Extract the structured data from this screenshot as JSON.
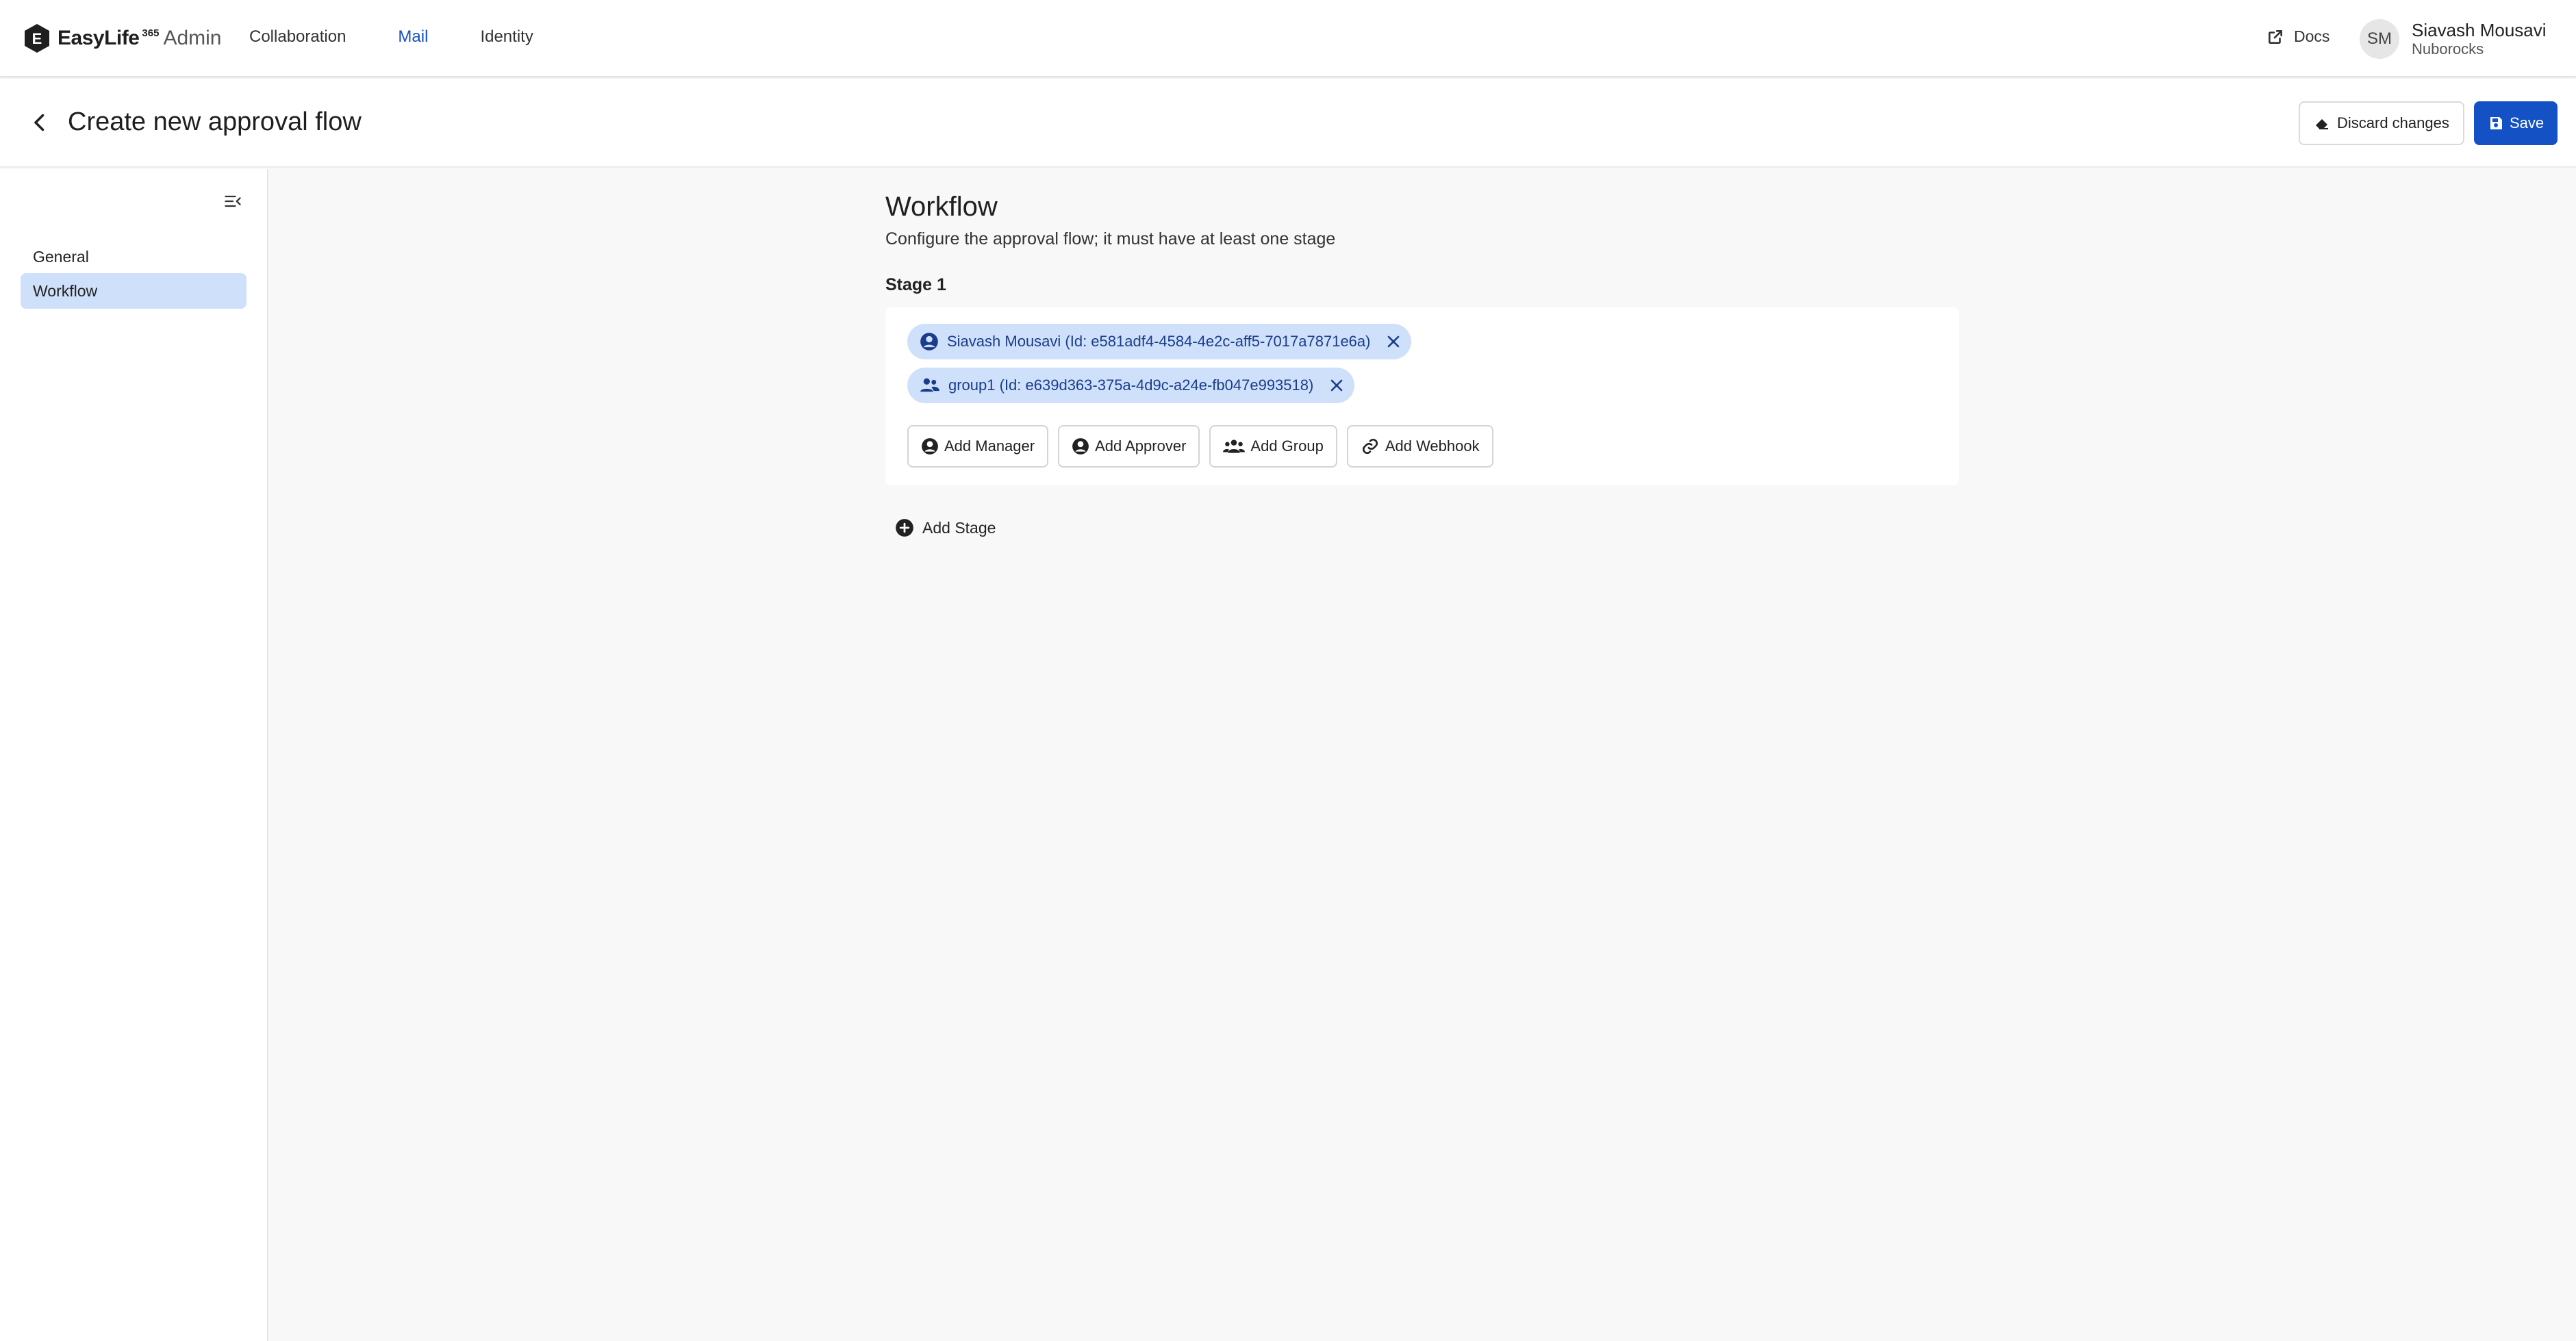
{
  "brand": {
    "name": "EasyLife",
    "superscript": "365",
    "suffix": "Admin"
  },
  "nav": {
    "items": [
      {
        "label": "Collaboration",
        "active": false
      },
      {
        "label": "Mail",
        "active": true
      },
      {
        "label": "Identity",
        "active": false
      }
    ]
  },
  "header_right": {
    "docs_label": "Docs",
    "user": {
      "initials": "SM",
      "name": "Siavash Mousavi",
      "org": "Nuborocks"
    }
  },
  "page": {
    "title": "Create new approval flow",
    "discard_label": "Discard changes",
    "save_label": "Save"
  },
  "sidebar": {
    "items": [
      {
        "label": "General",
        "active": false
      },
      {
        "label": "Workflow",
        "active": true
      }
    ]
  },
  "workflow": {
    "title": "Workflow",
    "description": "Configure the approval flow; it must have at least one stage",
    "stages": [
      {
        "label": "Stage 1",
        "approvers": [
          {
            "icon": "user-circle-icon",
            "text": "Siavash Mousavi (Id: e581adf4-4584-4e2c-aff5-7017a7871e6a)"
          },
          {
            "icon": "users-icon",
            "text": "group1 (Id: e639d363-375a-4d9c-a24e-fb047e993518)"
          }
        ],
        "actions": [
          {
            "icon": "user-circle-icon",
            "label": "Add Manager"
          },
          {
            "icon": "user-circle-icon",
            "label": "Add Approver"
          },
          {
            "icon": "users-icon",
            "label": "Add Group"
          },
          {
            "icon": "link-icon",
            "label": "Add Webhook"
          }
        ]
      }
    ],
    "add_stage_label": "Add Stage"
  },
  "colors": {
    "accent": "#1451c4",
    "chip_bg": "#cfe0fb",
    "active_side_bg": "#cfe0fb",
    "page_bg": "#f8f8f8"
  }
}
